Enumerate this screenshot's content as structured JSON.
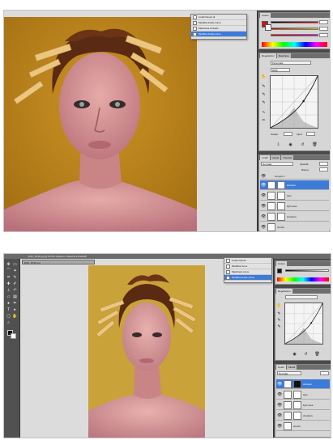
{
  "top": {
    "history": [
      {
        "label": "Livelli Nuova di"
      },
      {
        "label": "Modifica livello curve"
      },
      {
        "label": "Maschera di livello"
      },
      {
        "label": "Modifica livello curve"
      }
    ],
    "channel_preset": "RGB",
    "curves_input": "Input",
    "curves_output": "Output",
    "blend_mode": "Normale",
    "opacity_label": "Opacità:",
    "fill_label": "Riemp.:",
    "layers": [
      {
        "name": "Gruppo 1"
      },
      {
        "name": "sharpen"
      },
      {
        "name": "face"
      },
      {
        "name": "light area"
      },
      {
        "name": "shadows"
      },
      {
        "name": "sfondo"
      }
    ]
  },
  "bottom": {
    "menubar_title": "DSC_8731.jpg @ 33,3% (sharpen, Maschera livello/8)",
    "doc_tab": "DSC_8731.jpg",
    "history": [
      {
        "label": "Livello Nuovo"
      },
      {
        "label": "Modifica curve"
      },
      {
        "label": "Maschera curve"
      },
      {
        "label": "Modifica livello curve"
      }
    ],
    "blend_mode": "Normale",
    "layers": [
      {
        "name": "sharpen"
      },
      {
        "name": "face"
      },
      {
        "name": "light area"
      },
      {
        "name": "shadows"
      },
      {
        "name": "sfondo"
      }
    ]
  },
  "colors": {
    "background_mustard": "#c9901c",
    "skin": "#d79b9a",
    "hair": "#5a2a12",
    "clothespin": "#e8c27a",
    "selection_blue": "#3d7bd9",
    "panel_gray": "#d6d6d6",
    "workspace_gray": "#bdbdbd"
  }
}
